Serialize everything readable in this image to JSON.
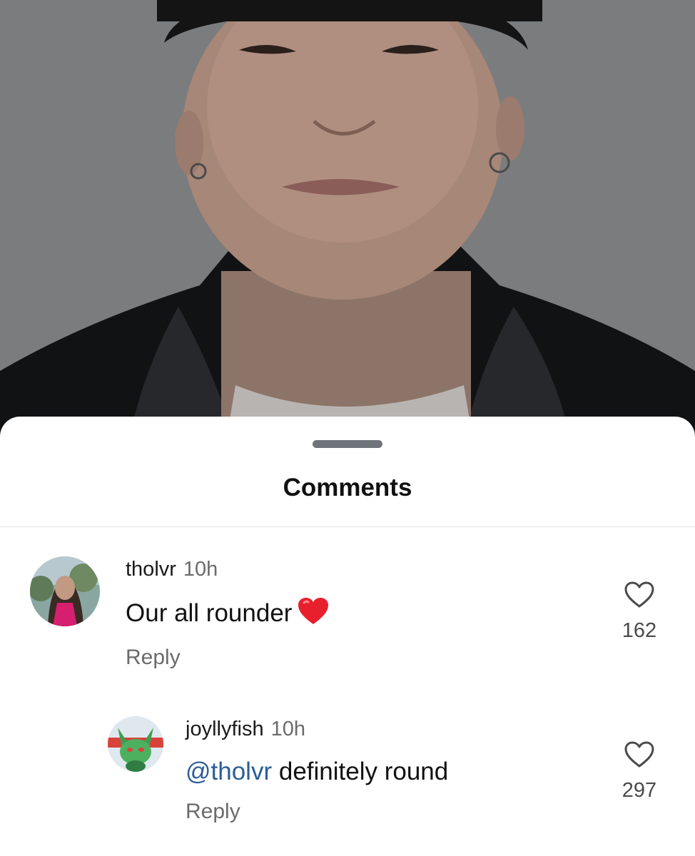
{
  "post": {
    "photo_icon": "portrait-photo"
  },
  "sheet": {
    "title": "Comments"
  },
  "comments": [
    {
      "username": "tholvr",
      "time": "10h",
      "text": "Our all rounder",
      "emoji": "red-heart-emoji",
      "reply_label": "Reply",
      "likes": "162",
      "avatar_icon": "profile-photo-avatar"
    },
    {
      "username": "joyllyfish",
      "time": "10h",
      "mention": "@tholvr",
      "text": " definitely round",
      "reply_label": "Reply",
      "likes": "297",
      "avatar_icon": "green-cat-character-avatar"
    }
  ],
  "colors": {
    "mention": "#2c5d97",
    "secondary_text": "#6b6b6b",
    "handle": "#6f747b"
  }
}
